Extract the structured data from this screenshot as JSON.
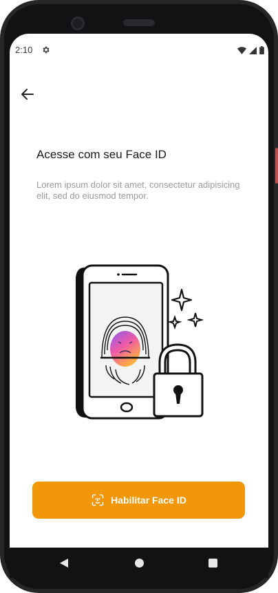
{
  "status_bar": {
    "time": "2:10",
    "icons": [
      "gear-icon",
      "wifi-icon",
      "signal-icon",
      "battery-icon"
    ]
  },
  "header": {
    "back_icon": "arrow-left-icon"
  },
  "main": {
    "title": "Acesse com seu Face ID",
    "subtitle": "Lorem ipsum dolor sit amet, consectetur adipisicing elit, sed do eiusmod tempor.",
    "illustration": "phone-fingerprint-padlock-illustration"
  },
  "cta": {
    "label": "Habilitar Face ID",
    "icon": "face-id-icon"
  },
  "navigation_bar": {
    "icons": [
      "nav-back-icon",
      "nav-home-icon",
      "nav-recent-icon"
    ]
  },
  "colors": {
    "accent": "#f2960a",
    "title": "#1a1a1a",
    "subtitle": "#9a9a9a",
    "device_frame": "#262628"
  }
}
